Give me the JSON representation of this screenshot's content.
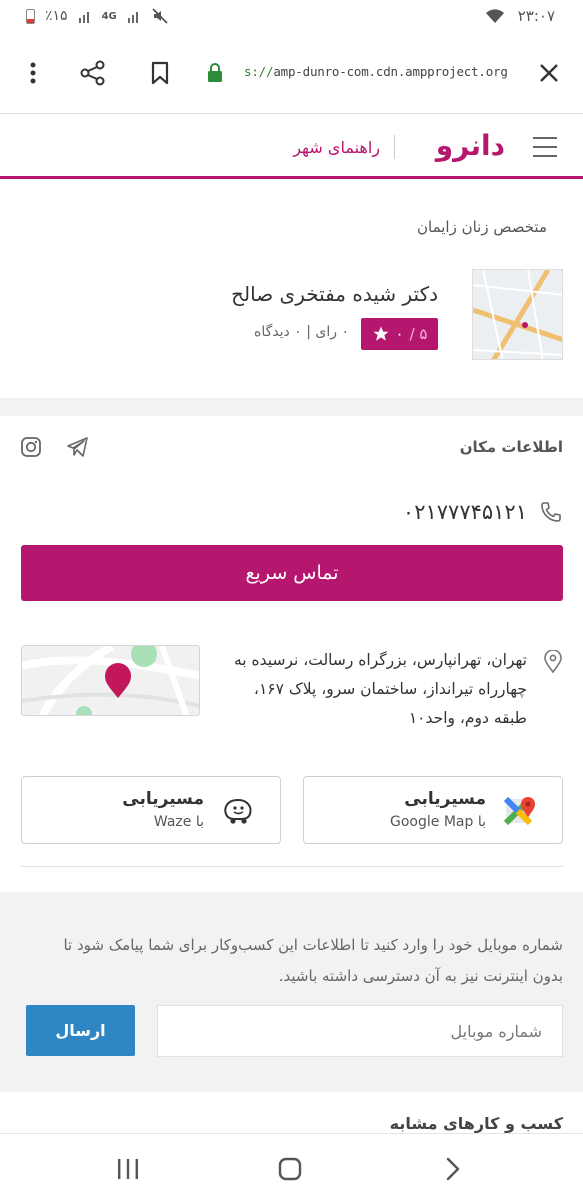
{
  "status_bar": {
    "time": "۲۳:۰۷",
    "battery": "٪۱۵",
    "network": "4G"
  },
  "browser": {
    "url_scheme": "s://",
    "url_host": "amp-dunro-com.cdn.ampproject.org"
  },
  "site": {
    "logo_text": "دانرو",
    "section_label": "راهنمای شهر"
  },
  "business": {
    "category": "متخصص زنان زایمان",
    "name": "دکتر شیده مفتخری صالح",
    "rating_value": "۰",
    "rating_max": "۵ /",
    "reviews_text": "۰ رای | ۰ دیدگاه"
  },
  "place_info": {
    "title": "اطلاعات مکان",
    "phone": "۰۲۱۷۷۷۴۵۱۲۱",
    "call_button_label": "تماس سریع",
    "address": "تهران، تهرانپارس، بزرگراه رسالت، نرسیده به چهارراه تیرانداز، ساختمان سرو، پلاک ۱۶۷، طبقه دوم، واحد۱۰",
    "nav_google": {
      "title": "مسیریابی",
      "subtitle": "با Google Map"
    },
    "nav_waze": {
      "title": "مسیریابی",
      "subtitle": "با Waze"
    }
  },
  "sms": {
    "description": "شماره موبایل خود را وارد کنید تا اطلاعات این کسب‌وکار برای شما پیامک شود تا بدون اینترنت نیز به آن دسترسی داشته باشید.",
    "input_placeholder": "شماره موبایل",
    "send_label": "ارسال"
  },
  "similar": {
    "title": "کسب و کارهای مشابه"
  },
  "colors": {
    "brand": "#b5176f",
    "send_button": "#2e87c4",
    "panel_bg": "#f2f2f2"
  },
  "icons": [
    "more-vert-icon",
    "share-icon",
    "bookmark-icon",
    "lock-icon",
    "close-icon",
    "hamburger-icon",
    "star-icon",
    "instagram-icon",
    "telegram-icon",
    "phone-icon",
    "location-pin-icon",
    "google-maps-icon",
    "waze-icon",
    "recents-icon",
    "home-icon",
    "back-icon"
  ]
}
